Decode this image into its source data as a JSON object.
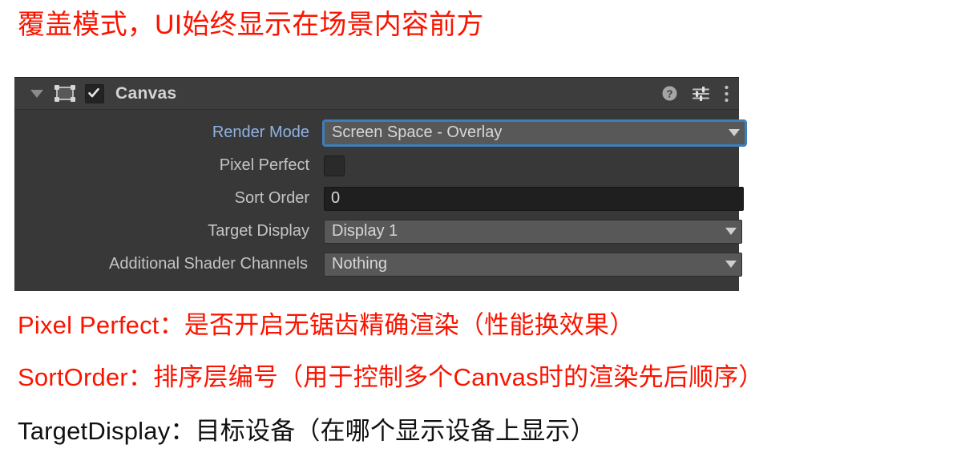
{
  "annotations": {
    "title": "覆盖模式，UI始终显示在场景内容前方",
    "line1": "Pixel Perfect：是否开启无锯齿精确渲染（性能换效果）",
    "line2": "SortOrder：排序层编号（用于控制多个Canvas时的渲染先后顺序）",
    "line3": "TargetDisplay：目标设备（在哪个显示设备上显示）",
    "title_color": "#fa1400",
    "line1_color": "#fa1400",
    "line2_color": "#fa1400",
    "line3_color": "#111111"
  },
  "inspector": {
    "component_name": "Canvas",
    "enabled": true,
    "expanded": true,
    "icons": {
      "foldout": "triangle-down-icon",
      "component": "canvas-icon",
      "enabled_checkbox": "checkbox-checked-icon",
      "help": "help-icon",
      "preset": "preset-sliders-icon",
      "menu": "kebab-menu-icon"
    },
    "colors": {
      "panel_bg": "#383838",
      "header_bg": "#3d3d3d",
      "dropdown_bg": "#585858",
      "textfield_bg": "#1f1f1f",
      "focus_ring": "#3d7ebd",
      "label": "#c4c4c4",
      "label_highlight": "#8fb2e3"
    },
    "properties": [
      {
        "label": "Render Mode",
        "control": "dropdown",
        "value": "Screen Space - Overlay",
        "focused": true,
        "label_highlighted": true
      },
      {
        "label": "Pixel Perfect",
        "control": "checkbox",
        "value": false
      },
      {
        "label": "Sort Order",
        "control": "textfield",
        "value": "0"
      },
      {
        "label": "Target Display",
        "control": "dropdown",
        "value": "Display 1",
        "focused": false
      },
      {
        "label": "Additional Shader Channels",
        "control": "dropdown",
        "value": "Nothing",
        "focused": false
      }
    ]
  }
}
